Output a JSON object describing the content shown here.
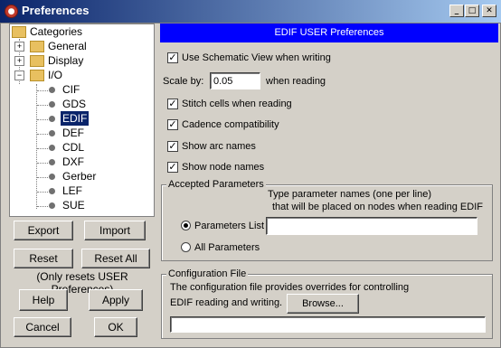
{
  "window": {
    "title": "Preferences",
    "app_icon_glyph": "●",
    "minimize": "_",
    "maximize": "□",
    "close": "✕"
  },
  "tree": {
    "root": "Categories",
    "folders": [
      "General",
      "Display",
      "I/O"
    ],
    "io_children": [
      "CIF",
      "GDS",
      "EDIF",
      "DEF",
      "CDL",
      "DXF",
      "Gerber",
      "LEF",
      "SUE"
    ],
    "selected": "EDIF",
    "expand_plus": "+",
    "expand_minus": "−"
  },
  "buttons": {
    "export": "Export",
    "import": "Import",
    "reset": "Reset",
    "reset_all": "Reset All",
    "reset_note": "(Only resets USER Preferences)",
    "help": "Help",
    "apply": "Apply",
    "cancel": "Cancel",
    "ok": "OK"
  },
  "panel": {
    "header": "EDIF USER Preferences",
    "use_schematic": "Use Schematic View when writing",
    "scale_label": "Scale by:",
    "scale_value": "0.05",
    "scale_suffix": "when reading",
    "stitch": "Stitch cells when reading",
    "cadence": "Cadence compatibility",
    "arc_names": "Show arc names",
    "node_names": "Show node names",
    "check_glyph": "✓"
  },
  "accepted": {
    "title": "Accepted Parameters",
    "desc_line1": "Type parameter names (one per line)",
    "desc_line2": "that will be placed on nodes when reading EDIF",
    "params_list": "Parameters List",
    "params_value": "",
    "all_params": "All Parameters"
  },
  "config": {
    "title": "Configuration File",
    "desc_line1": "The configuration file provides overrides for controlling",
    "desc_line2": "EDIF reading and writing.",
    "browse": "Browse...",
    "path_value": ""
  },
  "colors": {
    "titlebar_start": "#0a246a",
    "titlebar_end": "#a6caf0",
    "header_blue": "#0000ff",
    "selection": "#0a246a",
    "face": "#d4d0c8"
  }
}
